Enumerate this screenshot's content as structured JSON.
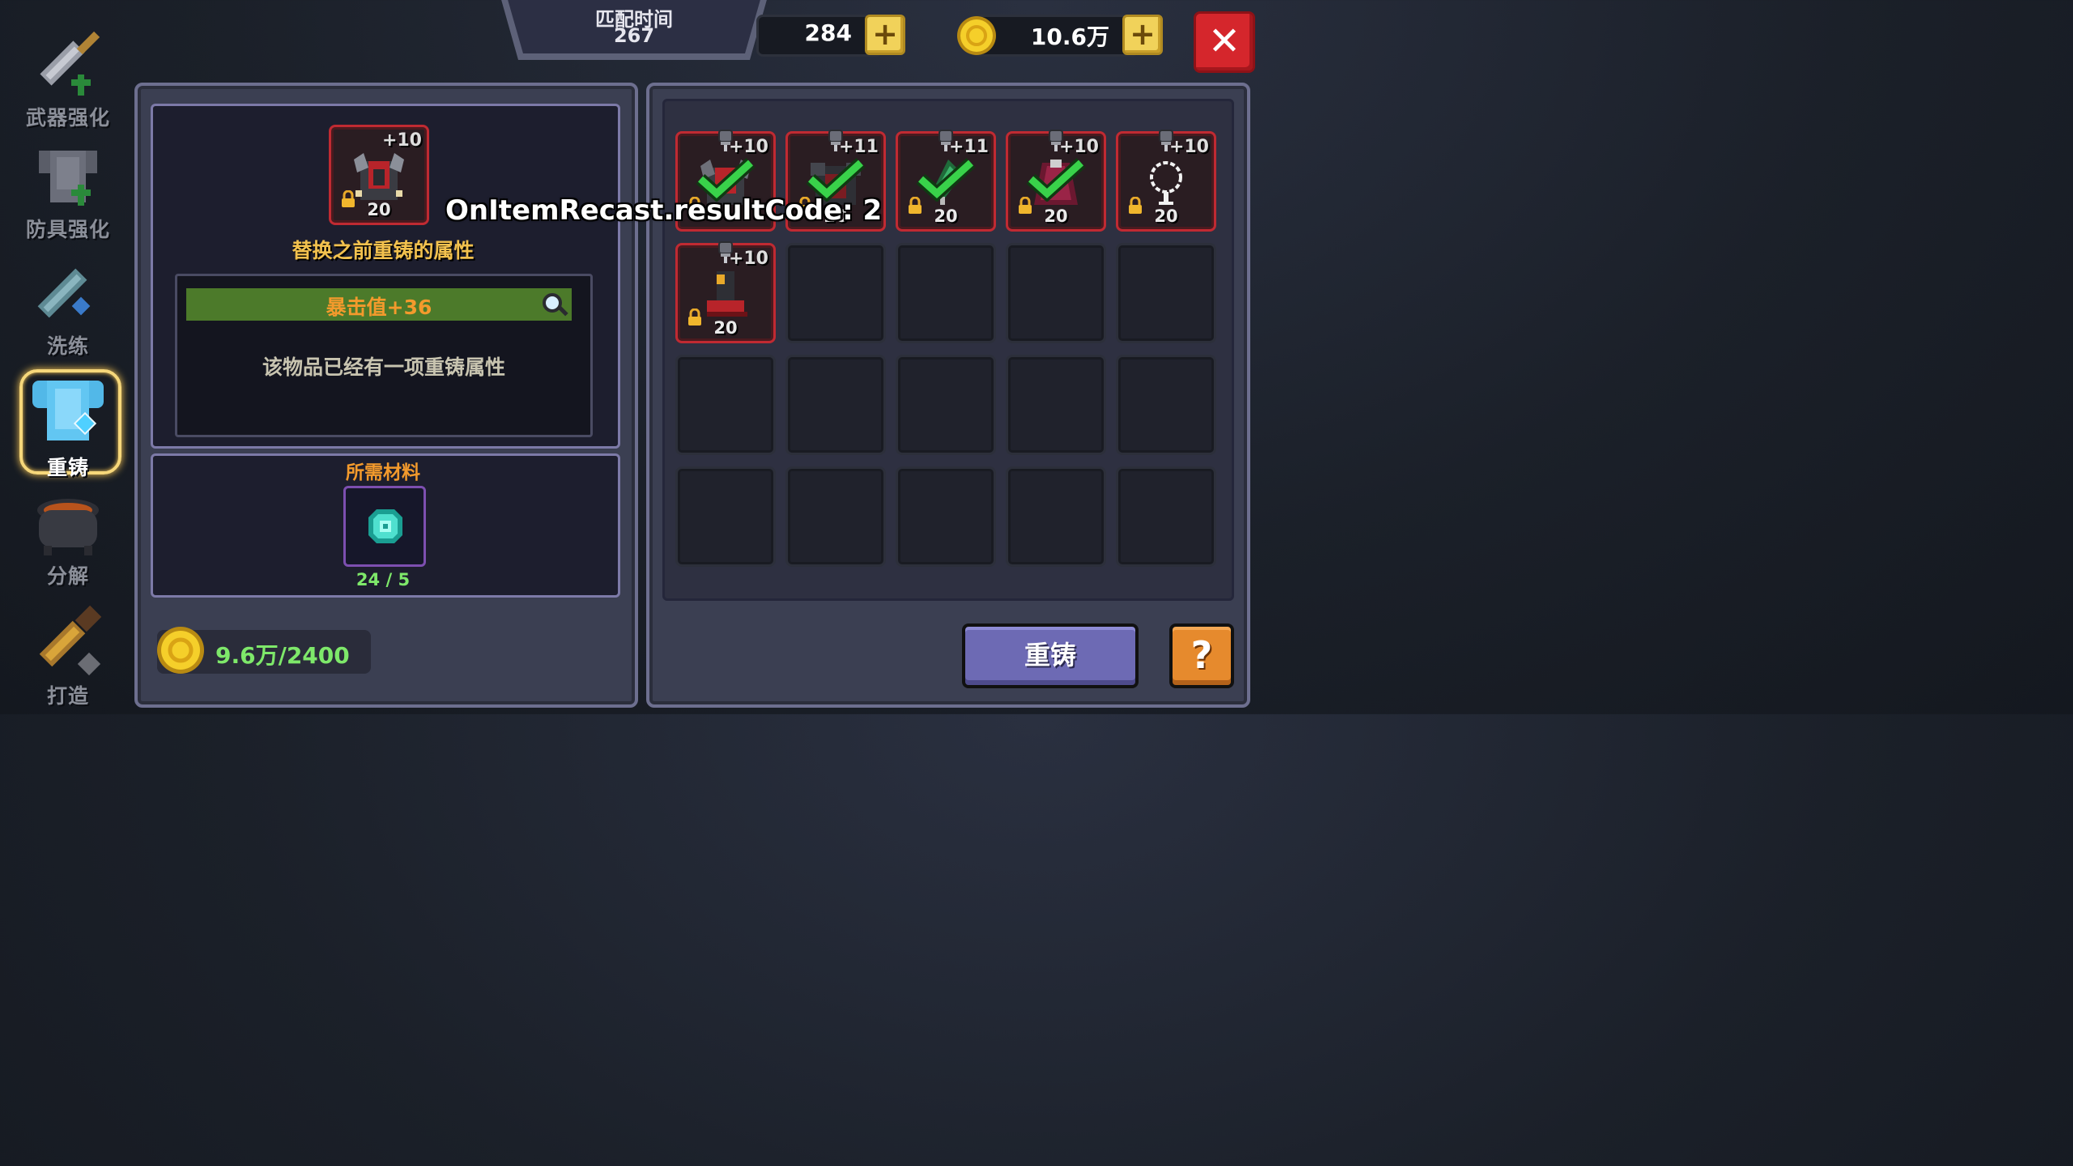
{
  "sidebar": {
    "items": [
      {
        "label": "武器强化",
        "icon": "sword-upgrade-icon",
        "active": false
      },
      {
        "label": "防具强化",
        "icon": "armor-upgrade-icon",
        "active": false
      },
      {
        "label": "洗练",
        "icon": "refine-sword-icon",
        "active": false
      },
      {
        "label": "重铸",
        "icon": "recast-armor-icon",
        "active": true
      },
      {
        "label": "分解",
        "icon": "cauldron-icon",
        "active": false
      },
      {
        "label": "打造",
        "icon": "forge-hammer-icon",
        "active": false
      }
    ]
  },
  "topbar": {
    "match_title": "匹配时间",
    "match_value": "267",
    "gems": "284",
    "gold": "10.6万"
  },
  "left_panel": {
    "item_level": "+10",
    "item_count": "20",
    "replace_hint": "替换之前重铸的属性",
    "attribute": "暴击值+36",
    "note": "该物品已经有一项重铸属性",
    "materials_title": "所需材料",
    "material_count": "24 / 5",
    "cost": "9.6万/2400"
  },
  "inventory": {
    "items": [
      {
        "level": "+10",
        "count": "",
        "checked": true,
        "kind": "red-armor"
      },
      {
        "level": "+11",
        "count": "20",
        "checked": true,
        "kind": "dark-armor"
      },
      {
        "level": "+11",
        "count": "20",
        "checked": true,
        "kind": "green-amulet"
      },
      {
        "level": "+10",
        "count": "20",
        "checked": true,
        "kind": "crimson-cape"
      },
      {
        "level": "+10",
        "count": "20",
        "checked": false,
        "kind": "ring"
      },
      {
        "level": "+10",
        "count": "20",
        "checked": false,
        "kind": "red-boots"
      }
    ],
    "empty_slots": 14
  },
  "buttons": {
    "recast": "重铸",
    "help": "?",
    "close": "✕"
  },
  "debug_text": "OnItemRecast.resultCode: 2",
  "colors": {
    "accent_gold": "#f1d25a",
    "attribute_bar": "#4c7a2a",
    "attribute_text": "#f39a2c",
    "hint_text": "#f2c14e",
    "materials_title": "#f39a2c",
    "cost_text": "#7ee86a",
    "slot_border": "#c02a32"
  }
}
